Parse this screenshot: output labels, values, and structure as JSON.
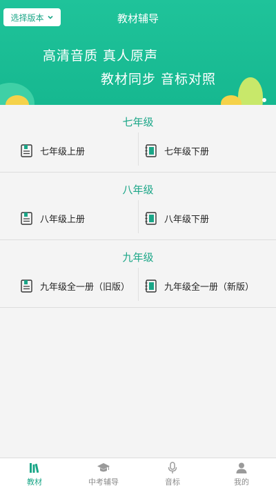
{
  "header": {
    "version_button_label": "选择版本",
    "title": "教材辅导",
    "slogan_line1": "高清音质 真人原声",
    "slogan_line2": "教材同步 音标对照"
  },
  "grades": [
    {
      "title": "七年级",
      "books": [
        "七年级上册",
        "七年级下册"
      ]
    },
    {
      "title": "八年级",
      "books": [
        "八年级上册",
        "八年级下册"
      ]
    },
    {
      "title": "九年级",
      "books": [
        "九年级全一册（旧版）",
        "九年级全一册（新版）"
      ]
    }
  ],
  "tabs": [
    {
      "label": "教材",
      "icon": "books-icon",
      "active": true
    },
    {
      "label": "中考辅导",
      "icon": "graduation-cap-icon",
      "active": false
    },
    {
      "label": "音标",
      "icon": "microphone-icon",
      "active": false
    },
    {
      "label": "我的",
      "icon": "user-icon",
      "active": false
    }
  ],
  "colors": {
    "accent": "#1aa687",
    "banner": "#1fc39a",
    "tab_inactive": "#8c8c8c"
  }
}
